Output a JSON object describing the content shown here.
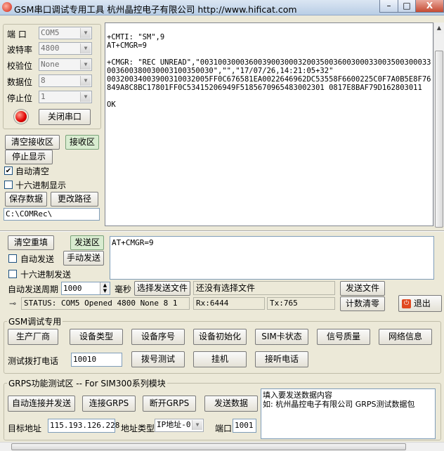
{
  "window": {
    "title": "GSM串口调试专用工具 杭州晶控电子有限公司  http://www.hificat.com",
    "minimize": "–",
    "maximize": "□",
    "close": "X"
  },
  "port": {
    "port_label": "端  口",
    "port_value": "COM5",
    "baud_label": "波特率",
    "baud_value": "4800",
    "parity_label": "校验位",
    "parity_value": "None",
    "databits_label": "数据位",
    "databits_value": "8",
    "stopbits_label": "停止位",
    "stopbits_value": "1",
    "close_port": "关闭串口"
  },
  "receive": {
    "clear": "清空接收区",
    "area_tag": "接收区",
    "stop_display": "停止显示",
    "auto_clear": "自动清空",
    "auto_clear_checked": "✔",
    "hex_display": "十六进制显示",
    "save_data": "保存数据",
    "change_path": "更改路径",
    "path": "C:\\COMRec\\",
    "text": "\n+CMTI: \"SM\",9\nAT+CMGR=9\n\n+CMGR: \"REC UNREAD\",\"0031003000360039003000320035003600300033003500300033003600380030003100350030\",\"\",\"17/07/26,14:21:05+32\"\n00320034003900310032005FF0C676581EA0022646962DC53558F6600225C0F7A0B5E8F76849A8C8BC17801FF0C53415206949F5185670965483002301 0817E8BAF79D162803011\n\nOK"
  },
  "send": {
    "clear_resend": "清空重填",
    "area_tag": "发送区",
    "auto_send": "自动发送",
    "manual_send": "手动发送",
    "hex_send": "十六进制发送",
    "text": "AT+CMGR=9",
    "period_label": "自动发送周期",
    "period_value": "1000",
    "ms_label": "毫秒",
    "choose_file": "选择发送文件",
    "file_status": "还没有选择文件",
    "send_file": "发送文件",
    "count_clear": "计数清零",
    "exit": "退出"
  },
  "status": {
    "text": "STATUS: COM5 Opened 4800 None 8 1",
    "rx": "Rx:6444",
    "tx": "Tx:765"
  },
  "gsm": {
    "title": "GSM调试专用",
    "manufacturer": "生产厂商",
    "device_type": "设备类型",
    "device_serial": "设备序号",
    "device_init": "设备初始化",
    "sim_status": "SIM卡状态",
    "signal_quality": "信号质量",
    "network_info": "网络信息",
    "test_dial_label": "测试拨打电话",
    "phone_number": "10010",
    "dial_test": "拨号测试",
    "hang_up": "挂机",
    "answer": "接听电话"
  },
  "grps": {
    "title": "GRPS功能测试区 -- For SIM300系列模块",
    "auto_connect_send": "自动连接并发送",
    "connect": "连接GRPS",
    "disconnect": "断开GRPS",
    "send_data": "发送数据",
    "target_label": "目标地址",
    "target_ip": "115.193.126.228",
    "addr_type_label": "地址类型",
    "addr_type_value": "IP地址-0",
    "port_label": "端口",
    "port_value": "1001",
    "hint_line1": "填入要发送数据内容",
    "hint_line2": "如: 杭州晶控电子有限公司  GRPS测试数据包"
  }
}
